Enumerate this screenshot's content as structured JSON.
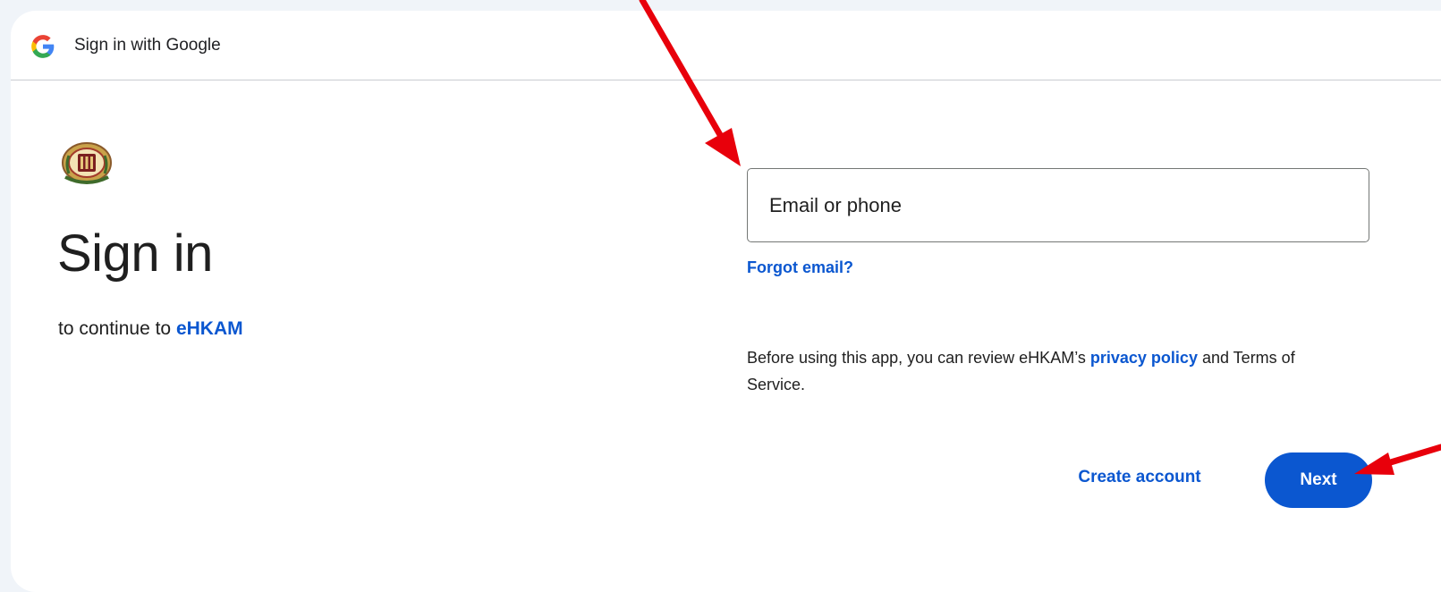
{
  "header": {
    "title": "Sign in with Google",
    "logo_icon": "google-g-icon"
  },
  "main": {
    "app_logo_icon": "ehkam-crest-icon",
    "heading": "Sign in",
    "subtitle_prefix": "to continue to",
    "app_name": "eHKAM"
  },
  "form": {
    "email_placeholder": "Email or phone",
    "email_value": "",
    "forgot_email": "Forgot email?"
  },
  "policy": {
    "text_before": "Before using this app, you can review eHKAM’s",
    "privacy_link": "privacy policy",
    "text_after": "and Terms of Service."
  },
  "actions": {
    "create_account": "Create account",
    "next": "Next"
  },
  "colors": {
    "accent": "#0b57d0",
    "page_background": "#f0f4f9",
    "annotation_arrow": "#e8000b"
  },
  "annotations": [
    "arrow-to-email-field",
    "arrow-to-next-button"
  ]
}
